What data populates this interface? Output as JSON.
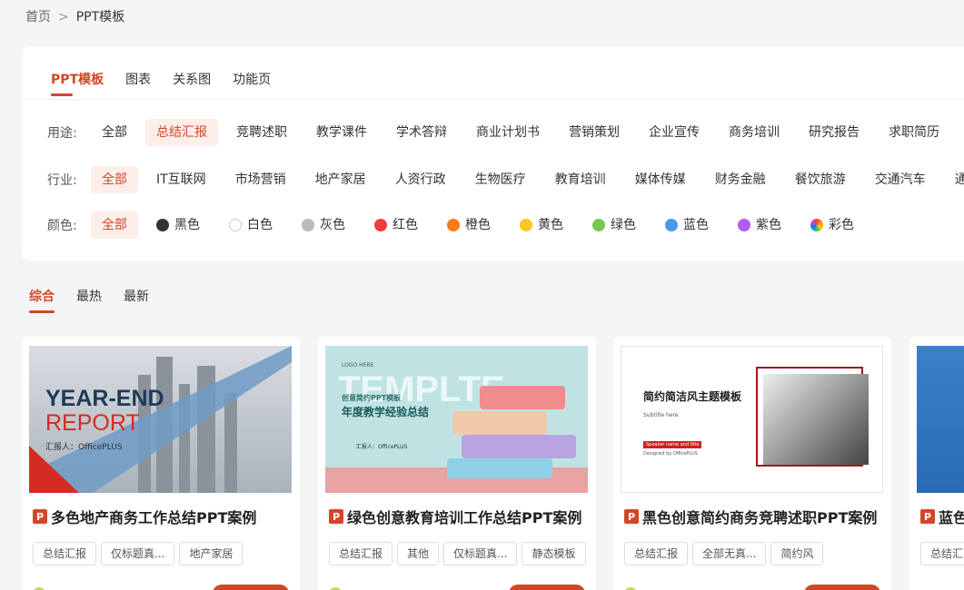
{
  "breadcrumb": {
    "home": "首页",
    "separator": ">",
    "current": "PPT模板"
  },
  "top_tabs": [
    "PPT模板",
    "图表",
    "关系图",
    "功能页"
  ],
  "filters": {
    "usage": {
      "label": "用途:",
      "options": [
        "全部",
        "总结汇报",
        "竞聘述职",
        "教学课件",
        "学术答辩",
        "商业计划书",
        "营销策划",
        "企业宣传",
        "商务培训",
        "研究报告",
        "求职简历"
      ],
      "active": "总结汇报"
    },
    "industry": {
      "label": "行业:",
      "options": [
        "全部",
        "IT互联网",
        "市场营销",
        "地产家居",
        "人资行政",
        "生物医疗",
        "教育培训",
        "媒体传媒",
        "财务金融",
        "餐饮旅游",
        "交通汽车",
        "通"
      ],
      "active": "全部"
    },
    "color": {
      "label": "颜色:",
      "active": "全部",
      "options": [
        {
          "name": "全部",
          "color": ""
        },
        {
          "name": "黑色",
          "color": "#333333"
        },
        {
          "name": "白色",
          "color": "#ffffff"
        },
        {
          "name": "灰色",
          "color": "#b8bcc2"
        },
        {
          "name": "红色",
          "color": "#f03c3c"
        },
        {
          "name": "橙色",
          "color": "#fa7d14"
        },
        {
          "name": "黄色",
          "color": "#fac81e"
        },
        {
          "name": "绿色",
          "color": "#78c850"
        },
        {
          "name": "蓝色",
          "color": "#4b96f0"
        },
        {
          "name": "紫色",
          "color": "#b45af0"
        },
        {
          "name": "彩色",
          "color": "rainbow"
        }
      ]
    }
  },
  "sort_tabs": [
    "综合",
    "最热",
    "最新"
  ],
  "cards": [
    {
      "title": "多色地产商务工作总结PPT案例",
      "icon": "P",
      "tags": [
        "总结汇报",
        "仅标题真...",
        "地产家居"
      ],
      "thumb": {
        "line1": "YEAR-END",
        "line2": "REPORT",
        "sub": "汇报人：OfficePLUS"
      }
    },
    {
      "title": "绿色创意教育培训工作总结PPT案例",
      "icon": "P",
      "tags": [
        "总结汇报",
        "其他",
        "仅标题真...",
        "静态模板"
      ],
      "thumb": {
        "bg": "TEMPLTE",
        "logo": "LOGO HERE",
        "small": "创意简约PPT模板",
        "title": "年度教学经验总结",
        "reporter": "汇报人：OfficePLUS"
      }
    },
    {
      "title": "黑色创意简约商务竞聘述职PPT案例",
      "icon": "P",
      "tags": [
        "总结汇报",
        "全部无真...",
        "简约风"
      ],
      "thumb": {
        "title": "简约简洁风主题模板",
        "sub": "Subtitle here",
        "name": "Speaker name and title",
        "designed": "Designed by OfficePLUS"
      }
    },
    {
      "title": "蓝色",
      "icon": "P",
      "tags": [
        "总结汇"
      ]
    }
  ]
}
